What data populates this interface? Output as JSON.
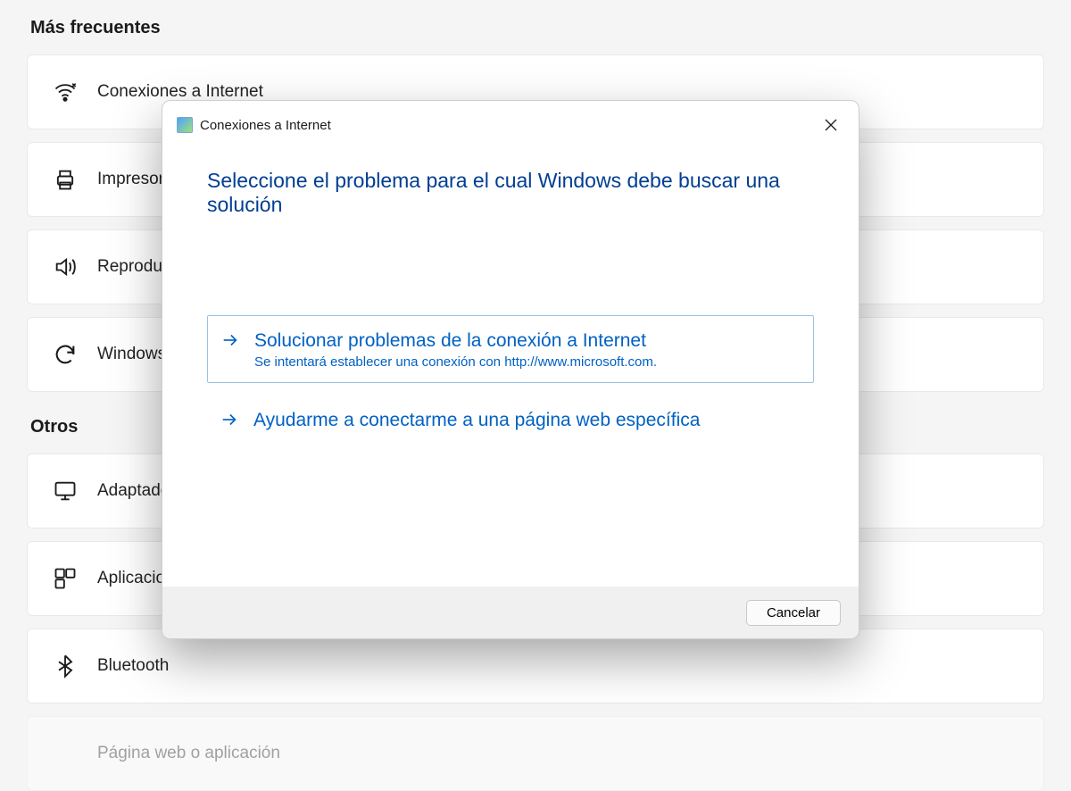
{
  "sections": {
    "frequent_title": "Más frecuentes",
    "others_title": "Otros"
  },
  "frequent_items": [
    {
      "label": "Conexiones a Internet",
      "icon": "wifi"
    },
    {
      "label": "Impresora",
      "icon": "printer"
    },
    {
      "label": "Reproducir audio",
      "icon": "speaker"
    },
    {
      "label": "Windows Update",
      "icon": "sync"
    }
  ],
  "other_items": [
    {
      "label": "Adaptador de red",
      "icon": "monitor"
    },
    {
      "label": "Aplicaciones",
      "icon": "apps"
    },
    {
      "label": "Bluetooth",
      "icon": "bluetooth"
    },
    {
      "label": "Página web o aplicación",
      "icon": ""
    }
  ],
  "dialog": {
    "title": "Conexiones a Internet",
    "heading": "Seleccione el problema para el cual Windows debe buscar una solución",
    "options": [
      {
        "label": "Solucionar problemas de la conexión a Internet",
        "sub": "Se intentará establecer una conexión con http://www.microsoft.com.",
        "selected": true
      },
      {
        "label": "Ayudarme a conectarme a una página web específica",
        "sub": "",
        "selected": false
      }
    ],
    "cancel": "Cancelar"
  }
}
